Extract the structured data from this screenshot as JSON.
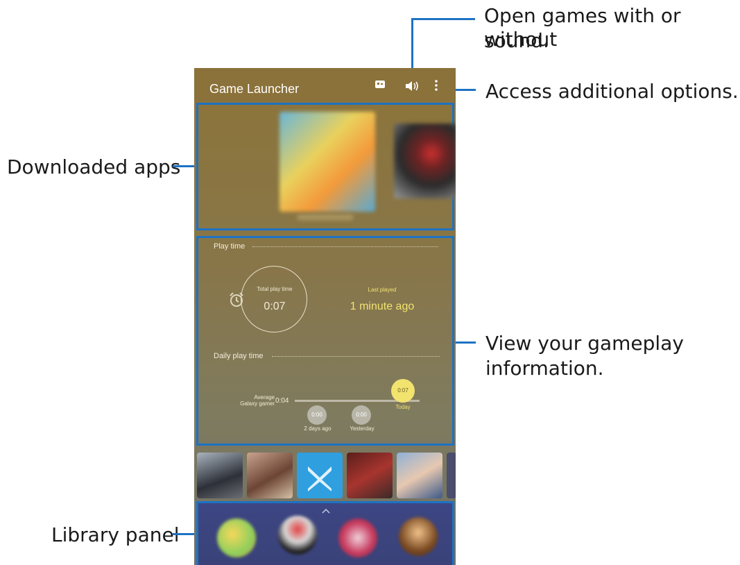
{
  "callouts": {
    "sound_line1": "Open games with or without",
    "sound_line2": "sound.",
    "options": "Access additional options.",
    "downloaded": "Downloaded apps",
    "gameplay_line1": "View your gameplay",
    "gameplay_line2": "information.",
    "library": "Library panel"
  },
  "appbar": {
    "title": "Game Launcher",
    "icons": [
      "game-tools-icon",
      "speaker-icon",
      "more-options-icon"
    ]
  },
  "play_time": {
    "section_title": "Play time",
    "total_label": "Total play time",
    "total_value": "0:07",
    "last_played_label": "Last played",
    "last_played_value": "1 minute ago"
  },
  "daily": {
    "section_title": "Daily play time",
    "average_label_line1": "Average",
    "average_label_line2": "Galaxy gamer",
    "average_value": "0:04",
    "days": [
      {
        "value": "0:00",
        "label": "2 days ago"
      },
      {
        "value": "0:00",
        "label": "Yesterday"
      },
      {
        "value": "0:07",
        "label": "Today"
      }
    ]
  },
  "colors": {
    "accent_blue": "#1d72c4",
    "highlight_yellow": "#f2e36f",
    "appbar": "#8b713a"
  }
}
